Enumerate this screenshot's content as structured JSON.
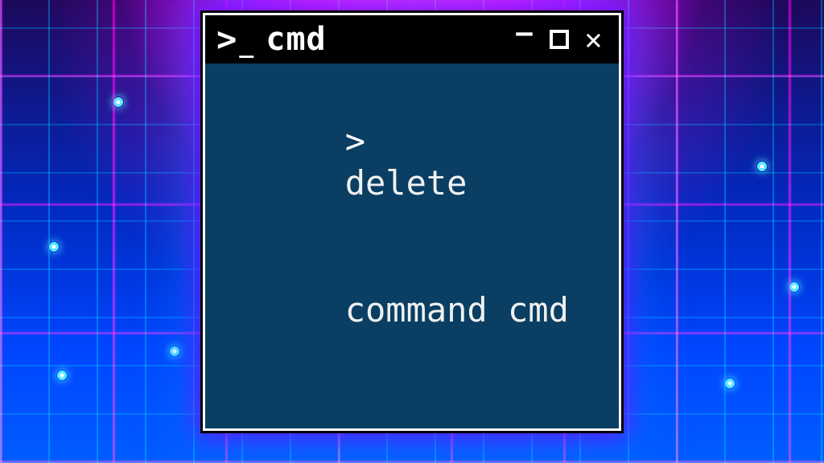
{
  "window": {
    "icon": {
      "name": "prompt-icon",
      "glyph_gt": ">",
      "glyph_underscore": "_"
    },
    "title": "cmd",
    "controls": {
      "minimize_glyph": "—",
      "maximize_glyph": "",
      "close_glyph": "✕"
    }
  },
  "terminal": {
    "prompt": ">",
    "lines": [
      "delete",
      "command cmd"
    ],
    "bg_color": "#0b3e63",
    "fg_color": "#eef1f0"
  }
}
